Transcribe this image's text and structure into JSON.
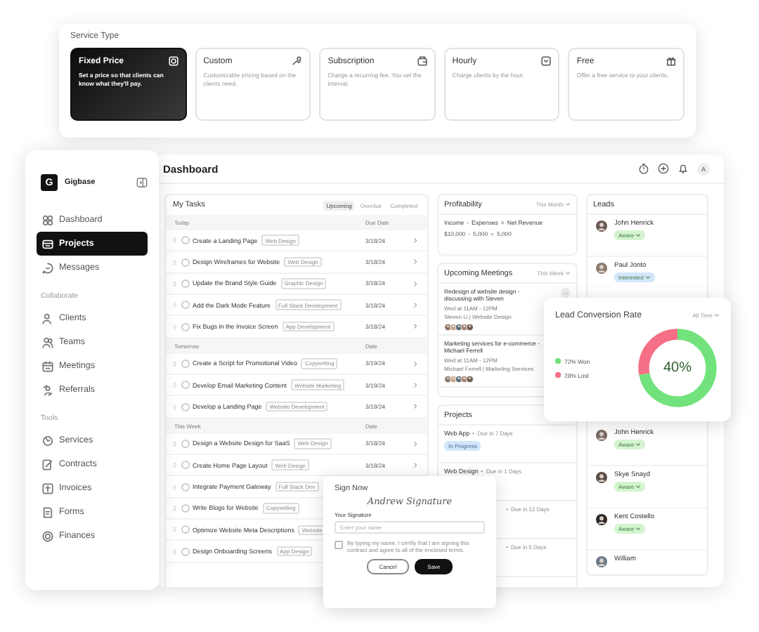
{
  "service_type": {
    "title": "Service Type",
    "options": [
      {
        "name": "Fixed Price",
        "description": "Set a price so that clients can know what they'll pay.",
        "selected": true
      },
      {
        "name": "Custom",
        "description": "Customizable pricing based on the clients need.",
        "selected": false
      },
      {
        "name": "Subscription",
        "description": "Charge a recurring fee. You set the interval.",
        "selected": false
      },
      {
        "name": "Hourly",
        "description": "Charge clients by the hour.",
        "selected": false
      },
      {
        "name": "Free",
        "description": "Offer a free service to your clients.",
        "selected": false
      }
    ]
  },
  "sidebar": {
    "logo": "G",
    "brand": "Gigbase",
    "sections": [
      {
        "items": [
          {
            "label": "Dashboard",
            "selected": false
          },
          {
            "label": "Projects",
            "selected": true
          },
          {
            "label": "Messages",
            "selected": false
          }
        ]
      },
      {
        "title": "Collaborate",
        "items": [
          {
            "label": "Clients",
            "selected": false
          },
          {
            "label": "Teams",
            "selected": false
          },
          {
            "label": "Meetings",
            "selected": false
          },
          {
            "label": "Referrals",
            "selected": false
          }
        ]
      },
      {
        "title": "Tools",
        "items": [
          {
            "label": "Services",
            "selected": false
          },
          {
            "label": "Contracts",
            "selected": false
          },
          {
            "label": "Invoices",
            "selected": false
          },
          {
            "label": "Forms",
            "selected": false
          },
          {
            "label": "Finances",
            "selected": false
          }
        ]
      }
    ]
  },
  "dashboard": {
    "title": "Dashboard",
    "user_initial": "A"
  },
  "tasks": {
    "title": "My Tasks",
    "tabs": [
      {
        "label": "Upcoming",
        "selected": true
      },
      {
        "label": "Overdue",
        "selected": false
      },
      {
        "label": "Completed",
        "selected": false
      }
    ],
    "groups": [
      {
        "label": "Today",
        "date_label": "Due Date",
        "tasks": [
          {
            "title": "Create a Landing Page",
            "tag": "Web Design",
            "due": "3/18/24",
            "checked": false
          },
          {
            "title": "Design Wireframes for Website",
            "tag": "Web Design",
            "due": "3/18/24",
            "checked": false
          },
          {
            "title": "Update the Brand Style Guide",
            "tag": "Graphic Design",
            "due": "3/18/24",
            "checked": false
          },
          {
            "title": "Add the Dark Mode Feature",
            "tag": "Full Stack Development",
            "due": "3/18/24",
            "checked": false
          },
          {
            "title": "Fix Bugs in the Invoice Screen",
            "tag": "App Development",
            "due": "3/18/24",
            "checked": false
          }
        ]
      },
      {
        "label": "Tomorrow",
        "date_label": "Date",
        "tasks": [
          {
            "title": "Create a Script for Promotional Video",
            "tag": "Copywriting",
            "due": "3/19/24",
            "checked": false
          },
          {
            "title": "Develop Email Marketing Content",
            "tag": "Website Marketing",
            "due": "3/19/24",
            "checked": false
          },
          {
            "title": "Develop a Landing Page",
            "tag": "Website Development",
            "due": "3/19/24",
            "checked": false
          }
        ]
      },
      {
        "label": "This Week",
        "date_label": "Date",
        "tasks": [
          {
            "title": "Design a Website Design for SaaS",
            "tag": "Web Design",
            "due": "3/18/24",
            "checked": false
          },
          {
            "title": "Create Home Page Layout",
            "tag": "Web Design",
            "due": "3/18/24",
            "checked": false
          },
          {
            "title": "Integrate Payment Gateway",
            "tag": "Full Stack Dev",
            "checked": false
          },
          {
            "title": "Write Blogs for Website",
            "tag": "Copywriting",
            "checked": false
          },
          {
            "title": "Optimize Website Meta Descriptions",
            "tag": "Website",
            "checked": false
          },
          {
            "title": "Design Onboarding Screens",
            "tag": "App Design",
            "checked": false
          }
        ]
      }
    ]
  },
  "profitability": {
    "title": "Profitability",
    "filter": "This Month",
    "formula": [
      "Income",
      "-",
      "Expenses",
      "=",
      "Net Revenue"
    ],
    "amounts": [
      "$10,000",
      "-",
      "5,000",
      "=",
      "5,000"
    ]
  },
  "meetings": {
    "title": "Upcoming Meetings",
    "filter": "This Week",
    "items": [
      {
        "title": "Redesign of website design - discussing with Steven",
        "time": "Wed at 11AM - 12PM",
        "meta": "Steven Li | Website Design",
        "menu": "···"
      },
      {
        "title": "Marketing services for e-commerce - Michael Ferrell",
        "time": "Wed at 11AM - 12PM",
        "meta": "Michael Ferrell | Marketing Services"
      }
    ]
  },
  "projects": {
    "title": "Projects",
    "items": [
      {
        "name": "Web App",
        "due": "Due in 7 Days",
        "status": "In Progress"
      },
      {
        "name": "Web Design",
        "due": "Due in 1 Days"
      },
      {
        "due": "Due in 12 Days"
      },
      {
        "due": "Due in 5 Days"
      }
    ]
  },
  "leads": {
    "title": "Leads",
    "items": [
      {
        "name": "John Henrick",
        "status": "Aware",
        "color": "#d4f5cf"
      },
      {
        "name": "Paul Jonto",
        "status": "Interested",
        "color": "#d3e6fb"
      },
      {
        "name": "John Henrick",
        "status": "Aware",
        "color": "#d4f5cf"
      },
      {
        "name": "Skye Snayd",
        "status": "Aware",
        "color": "#d4f5cf"
      },
      {
        "name": "Kent Costello",
        "status": "Aware",
        "color": "#d4f5cf"
      },
      {
        "name": "William"
      }
    ]
  },
  "lead_conversion": {
    "title": "Lead Conversion Rate",
    "filter": "All Time",
    "level": 0.72,
    "center": "40%",
    "legend": [
      {
        "label": "72% Won",
        "color": "#72e27c"
      },
      {
        "label": "28% Lost",
        "color": "#f56f86"
      }
    ]
  },
  "sign_dialog": {
    "title": "Sign Now",
    "signature": "Andrew Signature",
    "field_label": "Your Signature",
    "placeholder": "Enter your name",
    "consent": "By typing my name, I certify that I am signing this contract and agree to all of the enclosed terms.",
    "checked": false,
    "buttons": [
      "Cancel",
      "Save"
    ]
  }
}
